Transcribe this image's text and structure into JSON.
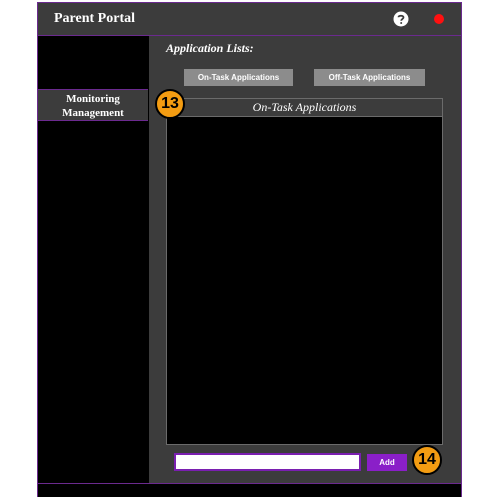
{
  "app": {
    "title": "Parent Portal",
    "accent_color": "#6b2a8f",
    "close_color": "#ff1010",
    "icons": [
      "help-icon",
      "close-icon"
    ]
  },
  "sidebar": {
    "items": [
      {
        "label_line1": "Monitoring",
        "label_line2": "Management"
      }
    ]
  },
  "main": {
    "section_title": "Application Lists:",
    "tabs": [
      {
        "label": "On-Task Applications"
      },
      {
        "label": "Off-Task Applications"
      }
    ],
    "list": {
      "header": "On-Task Applications",
      "items": []
    },
    "input": {
      "value": "",
      "placeholder": ""
    },
    "add_label": "Add",
    "add_color": "#8a1fc8"
  },
  "markers": [
    "13",
    "14"
  ]
}
